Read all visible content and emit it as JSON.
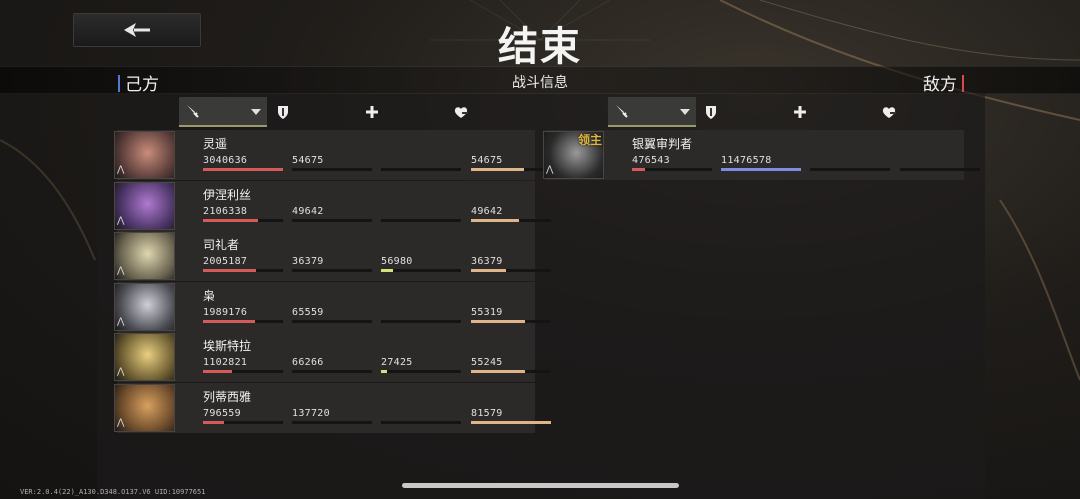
{
  "header": {
    "title": "结束",
    "back_icon": "arrow-left-icon"
  },
  "info_bar": {
    "ally_label": "己方",
    "center_label": "战斗信息",
    "enemy_label": "敌方"
  },
  "columns": [
    {
      "icon": "sword-icon",
      "meaning": "damage",
      "has_sort_arrow": true
    },
    {
      "icon": "shield-icon",
      "meaning": "damage-taken"
    },
    {
      "icon": "plus-icon",
      "meaning": "healing"
    },
    {
      "icon": "heart-shield-icon",
      "meaning": "damage-blocked"
    }
  ],
  "colors": {
    "damage_bar": "#d55a5a",
    "taken_bar": "#cc5a5a",
    "heal_bar": "#d8e07a",
    "block_bar": "#e0b48a",
    "enemy_taken_bar": "#7a8de0",
    "boss_tag": "#e0b840"
  },
  "allies": [
    {
      "name": "灵遥",
      "damage": "3040636",
      "damage_ratio": 1.0,
      "taken": "54675",
      "taken_ratio": 0.0,
      "heal": "",
      "heal_ratio": 0,
      "block": "54675",
      "block_ratio": 0.66
    },
    {
      "name": "伊涅利丝",
      "damage": "2106338",
      "damage_ratio": 0.69,
      "taken": "49642",
      "taken_ratio": 0.0,
      "heal": "",
      "heal_ratio": 0,
      "block": "49642",
      "block_ratio": 0.6
    },
    {
      "name": "司礼者",
      "damage": "2005187",
      "damage_ratio": 0.66,
      "taken": "36379",
      "taken_ratio": 0.0,
      "heal": "56980",
      "heal_ratio": 0.15,
      "block": "36379",
      "block_ratio": 0.44
    },
    {
      "name": "枭",
      "damage": "1989176",
      "damage_ratio": 0.65,
      "taken": "65559",
      "taken_ratio": 0.0,
      "heal": "",
      "heal_ratio": 0,
      "block": "55319",
      "block_ratio": 0.67
    },
    {
      "name": "埃斯特拉",
      "damage": "1102821",
      "damage_ratio": 0.36,
      "taken": "66266",
      "taken_ratio": 0.0,
      "heal": "27425",
      "heal_ratio": 0.08,
      "block": "55245",
      "block_ratio": 0.67
    },
    {
      "name": "列蒂西雅",
      "damage": "796559",
      "damage_ratio": 0.26,
      "taken": "137720",
      "taken_ratio": 0.0,
      "heal": "",
      "heal_ratio": 0,
      "block": "81579",
      "block_ratio": 1.0
    }
  ],
  "enemies": [
    {
      "name": "银翼审判者",
      "boss_tag": "领主",
      "damage": "476543",
      "damage_ratio": 0.16,
      "taken": "11476578",
      "taken_ratio": 1.0,
      "heal": "",
      "heal_ratio": 0,
      "block": "",
      "block_ratio": 0
    }
  ],
  "footer": {
    "version": "VER:2.0.4(22)_A130.D348.O137.V6   UID:10977651"
  }
}
